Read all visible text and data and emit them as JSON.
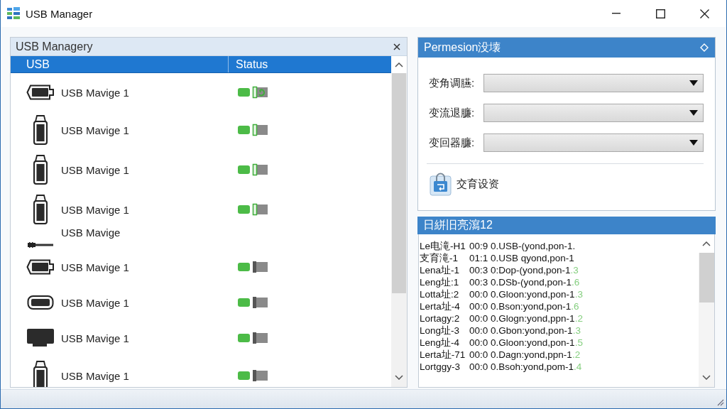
{
  "window": {
    "title": "USB Manager"
  },
  "devices_panel": {
    "title": "USB Managery",
    "columns": [
      "USB",
      "Status"
    ],
    "rows": [
      {
        "kind": "wide",
        "name": "USB Mavige 1",
        "connected": true,
        "syncing": true
      },
      {
        "kind": "stick",
        "name": "USB Mavige 1",
        "connected": true,
        "syncing": false
      },
      {
        "kind": "stick",
        "name": "USB Mavige 1",
        "connected": true,
        "syncing": false
      },
      {
        "kind": "stick",
        "name": "USB Mavige 1",
        "connected": true,
        "syncing": false
      },
      {
        "kind": "cable",
        "name": "USB Mavige"
      },
      {
        "kind": "wide",
        "name": "USB Mavige 1",
        "connected": false,
        "syncing": false
      },
      {
        "kind": "oval",
        "name": "USB Mavige 1",
        "connected": false,
        "syncing": false
      },
      {
        "kind": "monitor",
        "name": "USB Mavige 1",
        "connected": false,
        "syncing": false
      },
      {
        "kind": "stick",
        "name": "USB Mavige 1",
        "connected": false,
        "syncing": false
      }
    ]
  },
  "permission_panel": {
    "title": "Permesion没壊",
    "fields": [
      {
        "label": "变角调臙:"
      },
      {
        "label": "变流退臁:"
      },
      {
        "label": "变回器臁:"
      }
    ],
    "action": {
      "label": "交育设资"
    }
  },
  "log_panel": {
    "title": "日絣旧亮瀉12",
    "lines": [
      {
        "source": "Le电滝-H1",
        "message": "00:9 0.USB-(yond,pon-1."
      },
      {
        "source": "支育滝-1",
        "message": "01:1 0.USB qyond,pon-1"
      },
      {
        "source": "Lena址-1",
        "message": "00:3 0:Dop-(yond,pon-1",
        "tail": ".3"
      },
      {
        "source": "Leng址:1",
        "message": "00:3 0.DSb-(yond,pon-1",
        "tail": ".6"
      },
      {
        "source": "Lotta址:2",
        "message": "00:0 0.Gloon:yond,pon-1",
        "tail": ".3"
      },
      {
        "source": "Lerta址-4",
        "message": "00:0 0.Bson:yond,pon-1",
        "tail": ".6"
      },
      {
        "source": "Lortagy:2",
        "message": "00:0 0.Glogn:yond,ppn-1",
        "tail": ".2"
      },
      {
        "source": "Long址-3",
        "message": "00:0 0.Gbon:yond,pon-1",
        "tail": ".3"
      },
      {
        "source": "Leng址-4",
        "message": "00:0 0.Gloon:yond,pon-1",
        "tail": ".5"
      },
      {
        "source": "Lerta址-71",
        "message": "00:0 0.Dagn:yond,ppn-1",
        "tail": ".2"
      },
      {
        "source": "Lortggy-3",
        "message": "00:0 0.Bsoh:yond,pom-1",
        "tail": ".4"
      }
    ]
  }
}
